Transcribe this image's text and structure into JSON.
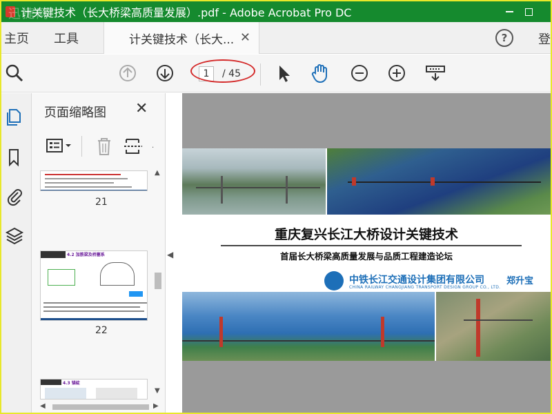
{
  "window": {
    "title": "计关键技术（长大桥梁高质量发展）.pdf - Adobe Acrobat Pro DC",
    "watermark": "迅捷网"
  },
  "tabs": {
    "home": "主页",
    "tools": "工具",
    "document": "计关键技术（长大...",
    "login": "登"
  },
  "toolbar": {
    "current_page": "1",
    "total_pages": "/ 45"
  },
  "thumbnails": {
    "title": "页面缩略图",
    "items": [
      {
        "label": "21"
      },
      {
        "label": "22"
      }
    ],
    "page22_header": "4.2 加筋梁及桥塞系",
    "page23_header": "4.3 锚碇"
  },
  "slide": {
    "title": "重庆复兴长江大桥设计关键技术",
    "subtitle": "首届长大桥梁高质量发展与品质工程建造论坛",
    "company": "中铁长江交通设计集团有限公司",
    "company_en": "CHINA RAILWAY CHANGJIANG TRANSPORT DESIGN GROUP CO., LTD.",
    "author": "郑升宝"
  },
  "colors": {
    "title_bar": "#158a2e",
    "accent_blue": "#1d6fb8",
    "annotation_red": "#d42a2a"
  }
}
